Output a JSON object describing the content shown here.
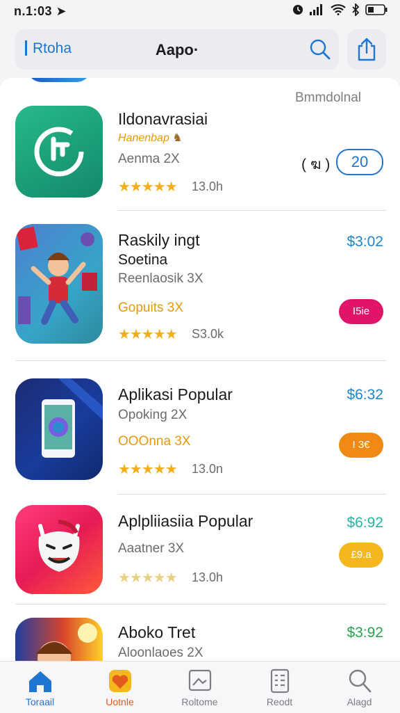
{
  "status": {
    "time": "n.1:03"
  },
  "header": {
    "back_label": "Rtoha",
    "title": "Aapo·"
  },
  "section": {
    "label": "Bmmdolnal"
  },
  "apps": [
    {
      "name": "Ildonavrasiai",
      "tag": "Hanenbap",
      "line": "Aenma 2X",
      "rating_count": "13.0h",
      "side_label": "( ฆ )",
      "price": "20"
    },
    {
      "name": "Raskily ingt",
      "name2": "Soetina",
      "line": "Reenlaosik 3X",
      "line2": "Gopuits 3X",
      "rating_count": "S3.0k",
      "price": "$3:02",
      "pill": "I5ie"
    },
    {
      "name": "Aplikasi Popular",
      "line": "Opoking 2X",
      "line2": "OOOnna 3X",
      "rating_count": "13.0n",
      "price": "$6:32",
      "pill": "I 3€"
    },
    {
      "name": "Aplpliiasiia Popular",
      "line": "Aaatner 3X",
      "rating_count": "13.0h",
      "price": "$6:92",
      "pill": "£9.a"
    },
    {
      "name": "Aboko Tret",
      "line": "Aloonlaoes 2X",
      "price": "$3:92"
    }
  ],
  "stars": "★★★★★",
  "tabs": [
    {
      "label": "Toraail",
      "icon": "home-icon",
      "color": "#1d76d2"
    },
    {
      "label": "Uotnle",
      "icon": "games-icon",
      "color": "#e35a1f"
    },
    {
      "label": "Roltome",
      "icon": "apps-icon",
      "color": "#7d7d83"
    },
    {
      "label": "Reodt",
      "icon": "updates-icon",
      "color": "#7d7d83"
    },
    {
      "label": "Alagd",
      "icon": "search-icon",
      "color": "#7d7d83"
    }
  ],
  "colors": {
    "accent": "#1d76d2",
    "price_blue": "#1d86c8",
    "price_teal": "#27b3a2",
    "price_green": "#2aa44d",
    "pink": "#e0156a",
    "orange": "#f08a14",
    "gold": "#f4b71e"
  }
}
